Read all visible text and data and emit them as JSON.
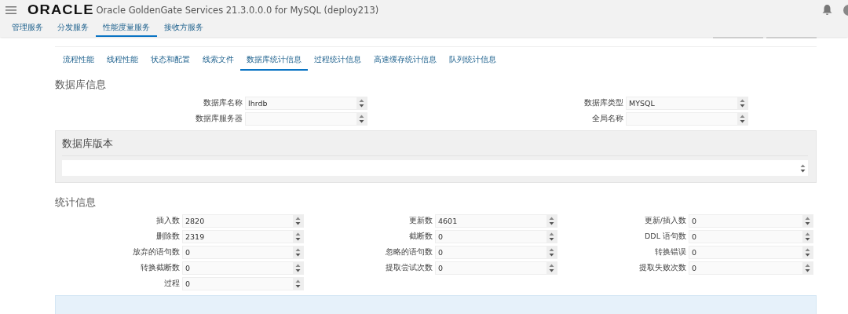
{
  "header": {
    "logo": "ORACLE",
    "title": "Oracle GoldenGate Services 21.3.0.0.0 for MySQL (deploy213)"
  },
  "nav_tabs": [
    {
      "label": "管理服务",
      "selected": false
    },
    {
      "label": "分发服务",
      "selected": false
    },
    {
      "label": "性能度量服务",
      "selected": true
    },
    {
      "label": "接收方服务",
      "selected": false
    }
  ],
  "sub_tabs": [
    {
      "label": "流程性能",
      "selected": false
    },
    {
      "label": "线程性能",
      "selected": false
    },
    {
      "label": "状态和配置",
      "selected": false
    },
    {
      "label": "线索文件",
      "selected": false
    },
    {
      "label": "数据库统计信息",
      "selected": true
    },
    {
      "label": "过程统计信息",
      "selected": false
    },
    {
      "label": "高速缓存统计信息",
      "selected": false
    },
    {
      "label": "队列统计信息",
      "selected": false
    }
  ],
  "db_info": {
    "heading": "数据库信息",
    "fields": [
      {
        "label": "数据库名称",
        "value": "lhrdb"
      },
      {
        "label": "数据库类型",
        "value": "MYSQL"
      },
      {
        "label": "数据库服务器"
      },
      {
        "label": "全局名称"
      }
    ],
    "version": {
      "heading": "数据库版本"
    }
  },
  "stats": {
    "heading": "统计信息",
    "fields": [
      {
        "label": "插入数",
        "value": "2820"
      },
      {
        "label": "更新数",
        "value": "4601"
      },
      {
        "label": "更新/插入数",
        "value": "0"
      },
      {
        "label": "删除数",
        "value": "2319"
      },
      {
        "label": "截断数",
        "value": "0"
      },
      {
        "label": "DDL 语句数",
        "value": "0"
      },
      {
        "label": "放弃的语句数",
        "value": "0"
      },
      {
        "label": "忽略的语句数",
        "value": "0"
      },
      {
        "label": "转换错误",
        "value": "0"
      },
      {
        "label": "转换截断数",
        "value": "0"
      },
      {
        "label": "提取尝试次数",
        "value": "0"
      },
      {
        "label": "提取失败次数",
        "value": "0"
      },
      {
        "label": "过程",
        "value": "0"
      }
    ]
  }
}
